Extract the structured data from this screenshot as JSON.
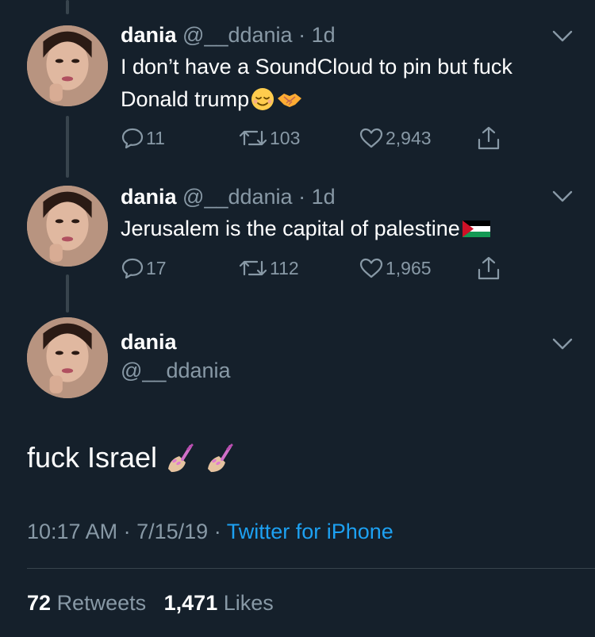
{
  "tweets": [
    {
      "name": "dania",
      "handle": "@__ddania",
      "age": "1d",
      "text": "I don’t have a SoundCloud to pin but fuck Donald trump",
      "emojis": [
        "relieved-face-emoji",
        "handshake-emoji"
      ],
      "replies": "11",
      "retweets": "103",
      "likes": "2,943"
    },
    {
      "name": "dania",
      "handle": "@__ddania",
      "age": "1d",
      "text": "Jerusalem is the capital of palestine",
      "emojis": [
        "palestine-flag-emoji"
      ],
      "replies": "17",
      "retweets": "112",
      "likes": "1,965"
    }
  ],
  "main": {
    "name": "dania",
    "handle": "@__ddania",
    "text": "fuck Israel",
    "emojis": [
      "nail-polish-emoji",
      "nail-polish-emoji"
    ],
    "time": "10:17 AM",
    "date": "7/15/19",
    "source": "Twitter for iPhone",
    "retweet_count": "72",
    "retweet_label": "Retweets",
    "like_count": "1,471",
    "like_label": "Likes"
  },
  "separator": "·",
  "colors": {
    "background": "#15202b",
    "muted": "#8899a6",
    "link": "#1da1f2",
    "divider": "#38444d"
  }
}
